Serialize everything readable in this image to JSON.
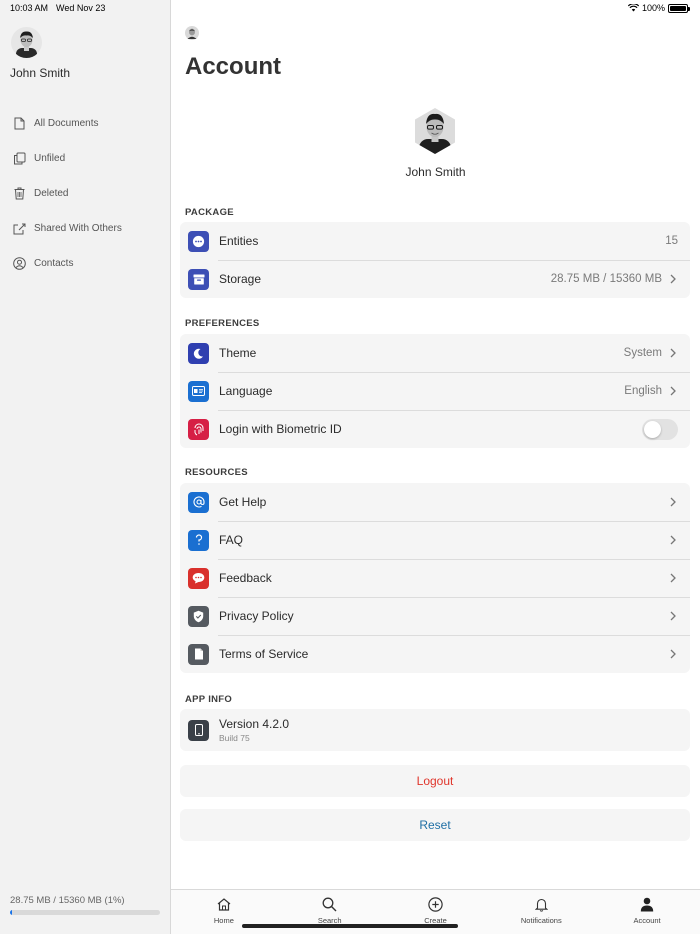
{
  "status_bar": {
    "time": "10:03 AM",
    "date": "Wed Nov 23",
    "battery": "100%"
  },
  "sidebar": {
    "user_name": "John Smith",
    "items": [
      {
        "label": "All Documents",
        "icon": "document-icon"
      },
      {
        "label": "Unfiled",
        "icon": "copy-icon"
      },
      {
        "label": "Deleted",
        "icon": "trash-icon"
      },
      {
        "label": "Shared With Others",
        "icon": "share-icon"
      },
      {
        "label": "Contacts",
        "icon": "contact-icon"
      }
    ],
    "storage_text": "28.75 MB / 15360 MB (1%)",
    "storage_fraction": 0.01
  },
  "main": {
    "title": "Account",
    "profile_name": "John Smith",
    "package": {
      "label": "PACKAGE",
      "rows": [
        {
          "label": "Entities",
          "value": "15",
          "icon": "more-dots-icon",
          "color": "#3d4fb5"
        },
        {
          "label": "Storage",
          "value": "28.75 MB / 15360 MB",
          "icon": "archive-icon",
          "color": "#3d4fb5"
        }
      ]
    },
    "preferences": {
      "label": "PREFERENCES",
      "rows": [
        {
          "label": "Theme",
          "value": "System",
          "icon": "moon-icon",
          "color": "#2f3fb0"
        },
        {
          "label": "Language",
          "value": "English",
          "icon": "language-icon",
          "color": "#1a6fd1"
        },
        {
          "label": "Login with Biometric ID",
          "icon": "fingerprint-icon",
          "color": "#d61f45",
          "toggle": false
        }
      ]
    },
    "resources": {
      "label": "RESOURCES",
      "rows": [
        {
          "label": "Get Help",
          "icon": "at-icon",
          "color": "#1a6fd1"
        },
        {
          "label": "FAQ",
          "icon": "question-icon",
          "color": "#1a6fd1"
        },
        {
          "label": "Feedback",
          "icon": "chat-bubble-icon",
          "color": "#d9302c"
        },
        {
          "label": "Privacy Policy",
          "icon": "shield-icon",
          "color": "#555a60"
        },
        {
          "label": "Terms of Service",
          "icon": "document-icon",
          "color": "#555a60"
        }
      ]
    },
    "app_info": {
      "label": "APP INFO",
      "version": "Version 4.2.0",
      "build": "Build 75"
    },
    "logout_label": "Logout",
    "reset_label": "Reset",
    "colors": {
      "logout": "#e0352b",
      "reset": "#1f6fa5"
    }
  },
  "tabbar": {
    "tabs": [
      {
        "label": "Home",
        "icon": "home-icon"
      },
      {
        "label": "Search",
        "icon": "search-icon"
      },
      {
        "label": "Create",
        "icon": "plus-circle-icon"
      },
      {
        "label": "Notifications",
        "icon": "bell-icon"
      },
      {
        "label": "Account",
        "icon": "person-icon",
        "active": true
      }
    ]
  }
}
